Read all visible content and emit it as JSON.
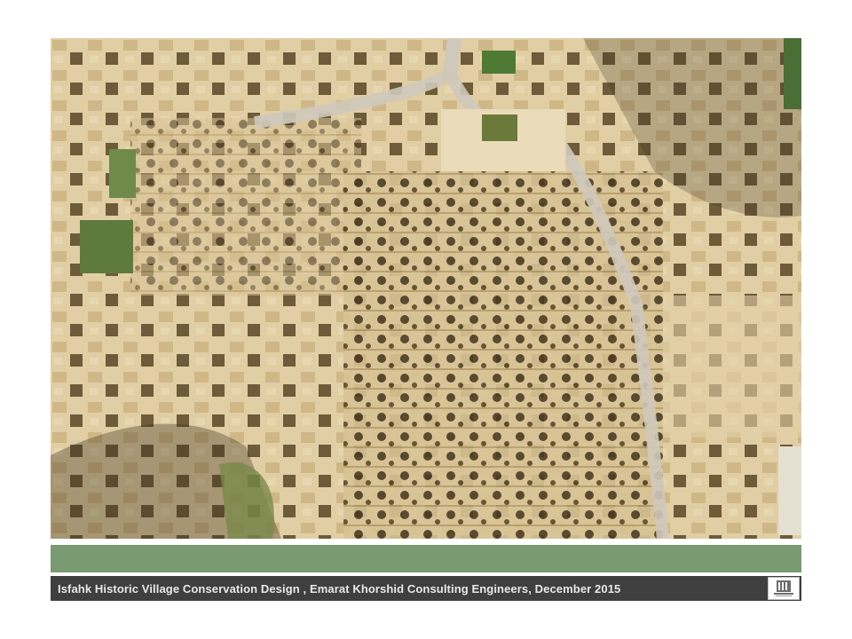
{
  "slide": {
    "caption": "Isfahk Historic Village Conservation Design , Emarat Khorshid Consulting Engineers, December 2015"
  },
  "photo": {
    "subject": "aerial view of mud-brick village",
    "ground_color": "#d9c49a",
    "shadow_color": "#4a3a22",
    "vegetation_color": "#6f8a4a"
  },
  "colors": {
    "band": "#7a9a72",
    "footer": "#3f3f3f"
  },
  "logo": {
    "icon": "building-logo-icon"
  }
}
